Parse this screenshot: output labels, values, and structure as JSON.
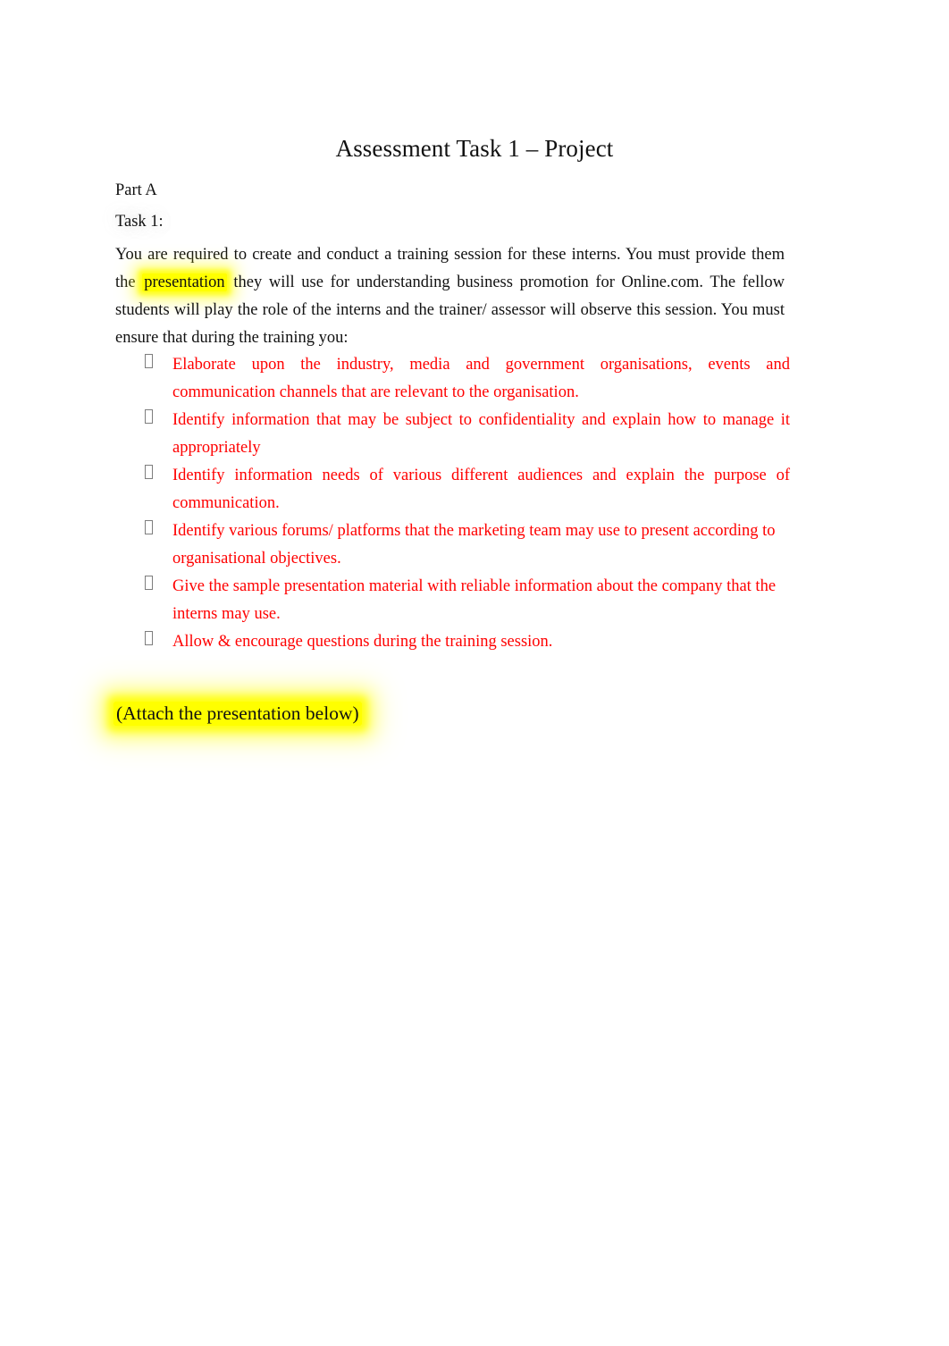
{
  "document": {
    "title": "Assessment Task 1 – Project",
    "part_label": "Part A",
    "task_label": "Task 1:",
    "intro": {
      "before_highlight": "You are required to create and conduct a training session for these interns. You must provide them the ",
      "highlight": "presentation",
      "after_highlight": " they will use for understanding business promotion for Online.com. The fellow students will play the role of the interns and the trainer/ assessor will observe this session. You must ensure that during the training you:"
    },
    "bullets": [
      "Elaborate upon the industry, media and government organisations, events and communication channels that are relevant to the organisation.",
      "Identify information that may be subject to confidentiality and explain how to manage it appropriately",
      "Identify information needs of various different audiences and explain the purpose of communication.",
      "Identify various forums/ platforms that the marketing team may use to present according to organisational objectives.",
      "Give the sample presentation material with reliable information about the company that the interns may use.",
      "Allow & encourage questions during the training session."
    ],
    "attach_note": "(Attach the presentation below)",
    "colors": {
      "bullet_text": "#ff0000",
      "highlight": "#ffff00",
      "body_text": "#111111",
      "page_background": "#ffffff",
      "bullet_marker_outline": "#7d7d7d"
    }
  }
}
